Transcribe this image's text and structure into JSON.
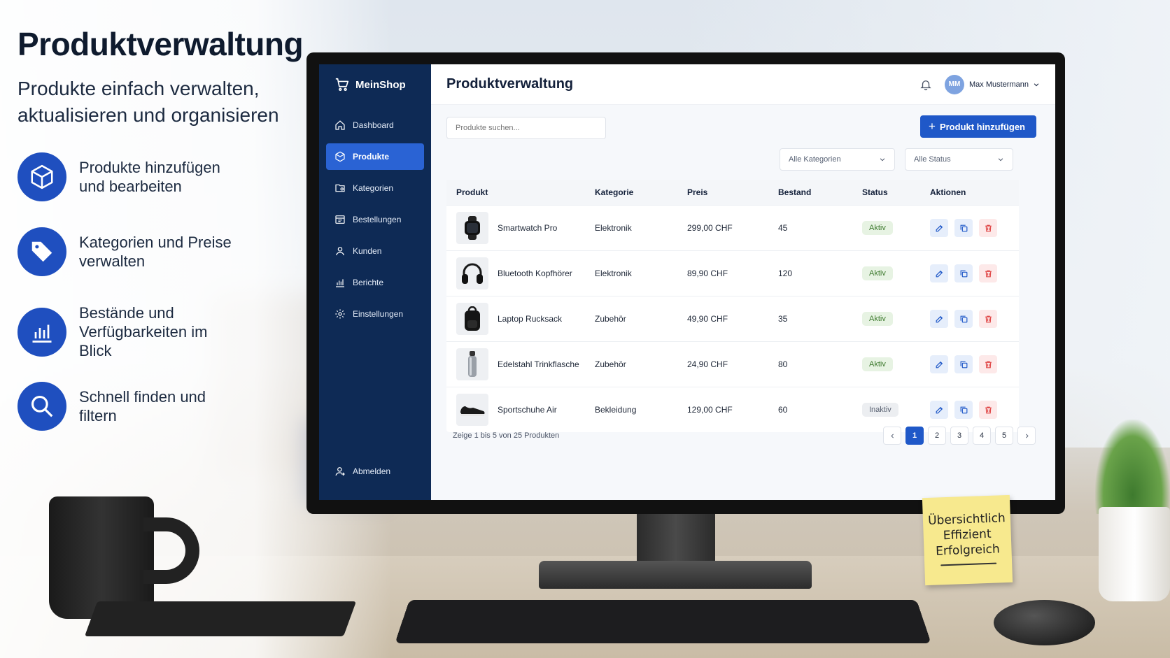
{
  "hero": {
    "title": "Produktverwaltung",
    "subtitle": "Produkte einfach verwalten, aktualisieren und organisieren",
    "features": [
      {
        "icon": "box-icon",
        "text": "Produkte hinzufügen und bearbeiten"
      },
      {
        "icon": "tag-icon",
        "text": "Kategorien und Preise verwalten"
      },
      {
        "icon": "bar-chart-icon",
        "text": "Bestände und Verfügbarkeiten im Blick"
      },
      {
        "icon": "search-icon",
        "text": "Schnell finden und filtern"
      }
    ]
  },
  "sticky_note": {
    "lines": [
      "Übersichtlich",
      "Effizient",
      "Erfolgreich"
    ]
  },
  "app": {
    "brand": "MeinShop",
    "sidebar": {
      "items": [
        {
          "label": "Dashboard",
          "icon": "home-icon",
          "active": false
        },
        {
          "label": "Produkte",
          "icon": "box-icon",
          "active": true
        },
        {
          "label": "Kategorien",
          "icon": "folder-icon",
          "active": false
        },
        {
          "label": "Bestellungen",
          "icon": "orders-icon",
          "active": false
        },
        {
          "label": "Kunden",
          "icon": "user-icon",
          "active": false
        },
        {
          "label": "Berichte",
          "icon": "bar-chart-icon",
          "active": false
        },
        {
          "label": "Einstellungen",
          "icon": "gear-icon",
          "active": false
        }
      ],
      "logout": "Abmelden"
    },
    "header": {
      "title": "Produktverwaltung",
      "user_initials": "MM",
      "user_name": "Max Mustermann"
    },
    "toolbar": {
      "search_placeholder": "Produkte suchen...",
      "add_button": "Produkt hinzufügen",
      "category_filter": "Alle Kategorien",
      "status_filter": "Alle Status"
    },
    "table": {
      "columns": [
        "Produkt",
        "Kategorie",
        "Preis",
        "Bestand",
        "Status",
        "Aktionen"
      ],
      "rows": [
        {
          "name": "Smartwatch Pro",
          "icon": "smartwatch-icon",
          "category": "Elektronik",
          "price": "299,00 CHF",
          "stock": "45",
          "status": "Aktiv"
        },
        {
          "name": "Bluetooth Kopfhörer",
          "icon": "headphones-icon",
          "category": "Elektronik",
          "price": "89,90 CHF",
          "stock": "120",
          "status": "Aktiv"
        },
        {
          "name": "Laptop Rucksack",
          "icon": "backpack-icon",
          "category": "Zubehör",
          "price": "49,90 CHF",
          "stock": "35",
          "status": "Aktiv"
        },
        {
          "name": "Edelstahl Trinkflasche",
          "icon": "bottle-icon",
          "category": "Zubehör",
          "price": "24,90 CHF",
          "stock": "80",
          "status": "Aktiv"
        },
        {
          "name": "Sportschuhe Air",
          "icon": "shoe-icon",
          "category": "Bekleidung",
          "price": "129,00 CHF",
          "stock": "60",
          "status": "Inaktiv"
        }
      ]
    },
    "pagination": {
      "summary": "Zeige 1 bis 5 von 25 Produkten",
      "pages": [
        "1",
        "2",
        "3",
        "4",
        "5"
      ],
      "current": "1"
    },
    "colors": {
      "sidebar": "#0e2a55",
      "accent": "#1f58c8",
      "active_badge": "#e7f3e3",
      "delete": "#e04848"
    }
  }
}
